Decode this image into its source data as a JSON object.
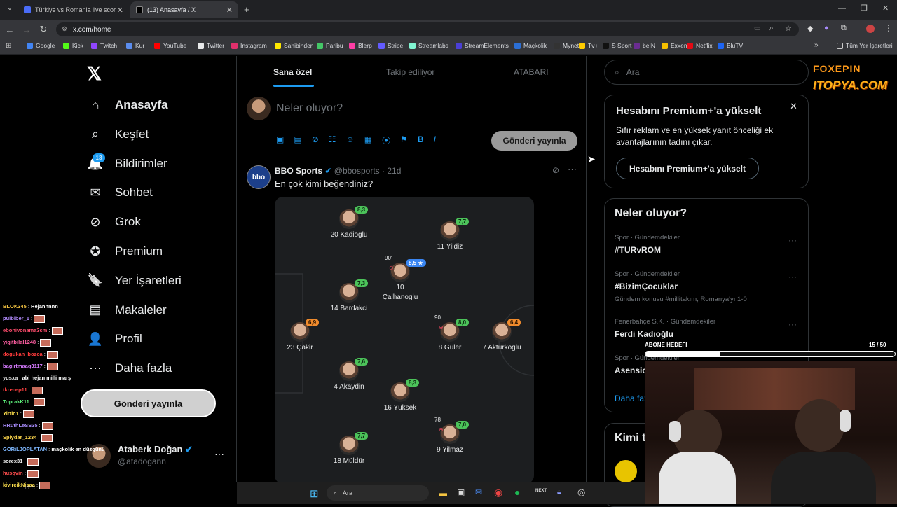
{
  "browser": {
    "tabs": [
      {
        "title": "Türkiye vs Romania live score, H",
        "color": "#4a6cf7"
      },
      {
        "title": "(13) Anasayfa / X",
        "color": "#000000"
      }
    ],
    "url": "x.com/home",
    "bookmarks": [
      {
        "label": "Google",
        "color": "#4285f4"
      },
      {
        "label": "Kick",
        "color": "#53fc18"
      },
      {
        "label": "Twitch",
        "color": "#9146ff"
      },
      {
        "label": "Kur",
        "color": "#5b8def"
      },
      {
        "label": "YouTube",
        "color": "#ff0000"
      },
      {
        "label": "Twitter",
        "color": "#e7e9ea"
      },
      {
        "label": "Instagram",
        "color": "#e1306c"
      },
      {
        "label": "Sahibinden",
        "color": "#ffe800"
      },
      {
        "label": "Paribu",
        "color": "#44c767"
      },
      {
        "label": "Blerp",
        "color": "#ff3ea5"
      },
      {
        "label": "Stripe",
        "color": "#635bff"
      },
      {
        "label": "Streamlabs",
        "color": "#80f5d2"
      },
      {
        "label": "StreamElements",
        "color": "#4b3fd6"
      },
      {
        "label": "Maçkolik",
        "color": "#2b6fd6"
      },
      {
        "label": "Mynet",
        "color": "#333333"
      },
      {
        "label": "Tv+",
        "color": "#ffcc00"
      },
      {
        "label": "S Sport",
        "color": "#111111"
      },
      {
        "label": "beIN",
        "color": "#6a2c91"
      },
      {
        "label": "Exxen",
        "color": "#f6c000"
      },
      {
        "label": "Netflix",
        "color": "#e50914"
      },
      {
        "label": "BluTV",
        "color": "#1d64f2"
      }
    ],
    "all_bookmarks": "Tüm Yer İşaretleri"
  },
  "nav": {
    "items": [
      {
        "label": "Anasayfa",
        "icon": "home-icon"
      },
      {
        "label": "Keşfet",
        "icon": "search-icon"
      },
      {
        "label": "Bildirimler",
        "icon": "bell-icon"
      },
      {
        "label": "Sohbet",
        "icon": "mail-icon"
      },
      {
        "label": "Grok",
        "icon": "grok-icon"
      },
      {
        "label": "Premium",
        "icon": "verified-icon"
      },
      {
        "label": "Yer İşaretleri",
        "icon": "bookmark-icon"
      },
      {
        "label": "Makaleler",
        "icon": "article-icon"
      },
      {
        "label": "Profil",
        "icon": "user-icon"
      },
      {
        "label": "Daha fazla",
        "icon": "more-circle-icon"
      }
    ],
    "notif_count": "13",
    "post_button": "Gönderi yayınla",
    "account": {
      "name": "Ataberk Doğan",
      "handle": "@atadogann"
    }
  },
  "timeline": {
    "tabs": [
      "Sana özel",
      "Takip ediliyor",
      "ATABARI"
    ],
    "compose_placeholder": "Neler oluyor?",
    "compose_button": "Gönderi yayınla",
    "tweet": {
      "author": "BBO Sports",
      "handle": "@bbosports",
      "time": "21d",
      "text": "En çok kimi beğendiniz?"
    },
    "players": [
      {
        "name": "20 Kadioglu",
        "rating": "8,3",
        "tone": "green"
      },
      {
        "name": "11 Yildiz",
        "rating": "7,7",
        "tone": "green"
      },
      {
        "name": "Çalhanoglu",
        "rating": "8,5 ★",
        "tone": "blue",
        "number": "10",
        "minute": "90'"
      },
      {
        "name": "14 Bardakci",
        "rating": "7,3",
        "tone": "green"
      },
      {
        "name": "23 Çakir",
        "rating": "6,9",
        "tone": "orange"
      },
      {
        "name": "8 Güler",
        "rating": "8,0",
        "tone": "green",
        "minute": "90'"
      },
      {
        "name": "7 Aktürkoglu",
        "rating": "6,4",
        "tone": "orange"
      },
      {
        "name": "4 Akaydin",
        "rating": "7,6",
        "tone": "green"
      },
      {
        "name": "16 Yüksek",
        "rating": "8,3",
        "tone": "green"
      },
      {
        "name": "9 Yilmaz",
        "rating": "7,0",
        "tone": "green",
        "minute": "78'"
      },
      {
        "name": "18 Müldür",
        "rating": "7,7",
        "tone": "green"
      }
    ]
  },
  "right": {
    "search_placeholder": "Ara",
    "premium": {
      "title": "Hesabını Premium+'a yükselt",
      "body": "Sıfır reklam ve en yüksek yanıt önceliği ek avantajlarının tadını çıkar.",
      "button": "Hesabını Premium+'a yükselt"
    },
    "trends_title": "Neler oluyor?",
    "trends": [
      {
        "meta": "Spor · Gündemdekiler",
        "name": "#TURvROM",
        "extra": ""
      },
      {
        "meta": "Spor · Gündemdekiler",
        "name": "#BizimÇocuklar",
        "extra": "Gündem konusu #millitakım, Romanya'yı 1-0"
      },
      {
        "meta": "Fenerbahçe S.K. · Gündemdekiler",
        "name": "Ferdi Kadıoğlu",
        "extra": ""
      },
      {
        "meta": "Spor · Gündemdekiler",
        "name": "Asensio",
        "extra": ""
      }
    ],
    "show_more": "Daha fazla",
    "who_to_follow": "Kimi takip etmeli"
  },
  "overlay": {
    "goal_label": "ABONE HEDEFİ",
    "goal_current": "15",
    "goal_total": "/ 50",
    "goal_progress": 0.3,
    "logo": "ITOPYA.COM",
    "logo2": "FOXEPIN"
  },
  "chat": [
    {
      "user": "BLOK345",
      "msg": "Hejannnnn",
      "color": "#f5c542"
    },
    {
      "user": "pulbiber_1",
      "msg": "",
      "color": "#b38cff"
    },
    {
      "user": "ebonivonama3cm",
      "msg": "",
      "color": "#ff4d6d"
    },
    {
      "user": "yigitbilal1248",
      "msg": "",
      "color": "#ff5fa2"
    },
    {
      "user": "dogukan_bozca",
      "msg": "",
      "color": "#ff3b3b"
    },
    {
      "user": "bagirtmaaq3117",
      "msg": "",
      "color": "#d77bff"
    },
    {
      "user": "yusxa",
      "msg": "abi hejan milli marş",
      "color": "#f0f0f0"
    },
    {
      "user": "tkrecep11",
      "msg": "",
      "color": "#ff4040"
    },
    {
      "user": "ToprakK11",
      "msg": "",
      "color": "#5df07a"
    },
    {
      "user": "Yirtic1",
      "msg": "",
      "color": "#ffe14d"
    },
    {
      "user": "RRuthLeSS35",
      "msg": "",
      "color": "#a78bfa"
    },
    {
      "user": "Spiydar_1234",
      "msg": "",
      "color": "#ffd84d"
    },
    {
      "user": "GORiLJOPLATAN",
      "msg": "maçkolik en düzgünü",
      "color": "#7fb8ff"
    },
    {
      "user": "sorex31",
      "msg": "",
      "color": "#f0f0f0"
    },
    {
      "user": "husqvin",
      "msg": "",
      "color": "#ff4d4d"
    },
    {
      "user": "kivircikNisaa",
      "msg": "",
      "color": "#ffe14d"
    }
  ],
  "taskbar": {
    "search": "Ara",
    "weather": "10°C"
  }
}
